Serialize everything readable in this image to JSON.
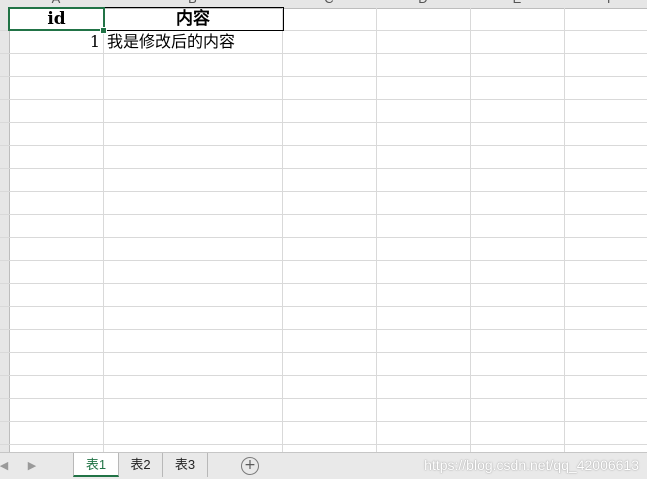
{
  "grid": {
    "column_headers": [
      "A",
      "B",
      "C",
      "D",
      "E",
      "F"
    ],
    "header_row": {
      "a": "id",
      "b": "内容"
    },
    "data_rows": [
      {
        "a": "1",
        "b": "我是修改后的内容"
      }
    ]
  },
  "sheet_tabs": [
    {
      "label": "表1",
      "selected": true
    },
    {
      "label": "表2",
      "selected": false
    },
    {
      "label": "表3",
      "selected": false
    }
  ],
  "nav": {
    "prev": "◀",
    "next": "▶"
  },
  "add_sheet_symbol": "+",
  "watermark": "https://blog.csdn.net/qq_42006613",
  "colors": {
    "accent": "#217346",
    "gridline": "#d9d9d9",
    "header_bg": "#e6e6e6"
  }
}
